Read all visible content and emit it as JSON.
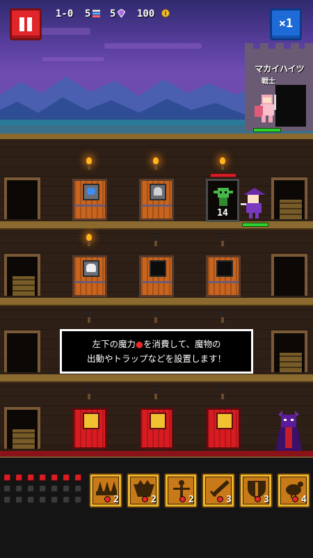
{
  "hud": {
    "stage": "1-0",
    "pieces": "5",
    "gems": "5",
    "coins": "100",
    "speed_label": "×1"
  },
  "castle": {
    "sign": "マカイハイツ",
    "label": "戦士"
  },
  "tooltip": {
    "line1_before": "左下の魔力",
    "line1_after": "を消費して、魔物の",
    "line2": "出動やトラップなどを設置します！"
  },
  "goblin_count": "14",
  "mana": {
    "filled": 7,
    "total": 21
  },
  "cards": [
    {
      "name": "spikes-card",
      "icon": "spike-trap-icon",
      "cost": "2"
    },
    {
      "name": "pit-card",
      "icon": "pit-trap-icon",
      "cost": "2"
    },
    {
      "name": "scarecrow-card",
      "icon": "scarecrow-icon",
      "cost": "2"
    },
    {
      "name": "sword-card",
      "icon": "sword-icon",
      "cost": "3"
    },
    {
      "name": "shield-card",
      "icon": "shield-icon",
      "cost": "3"
    },
    {
      "name": "chicken-card",
      "icon": "chicken-icon",
      "cost": "4"
    }
  ],
  "colors": {
    "pause": "#e0252b",
    "speed": "#1e6bd8",
    "mana": "#d81c21",
    "card": "#f0b62a"
  }
}
